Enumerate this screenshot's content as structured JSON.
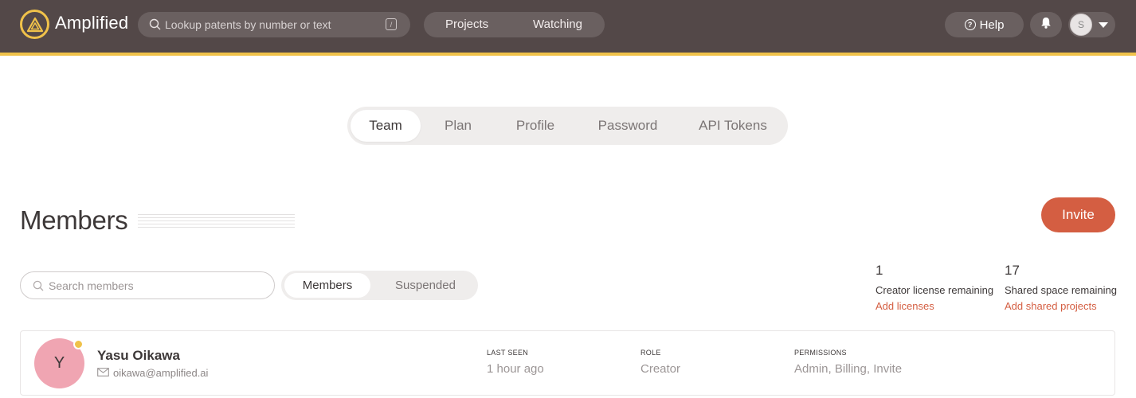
{
  "header": {
    "brand": "Amplified",
    "search_placeholder": "Lookup patents by number or text",
    "search_shortcut": "/",
    "nav": [
      {
        "label": "Projects"
      },
      {
        "label": "Watching"
      }
    ],
    "help_label": "Help",
    "help_glyph": "?",
    "user_initial": "S",
    "accent_color": "#f0c24a"
  },
  "settings_tabs": [
    {
      "label": "Team",
      "active": true
    },
    {
      "label": "Plan"
    },
    {
      "label": "Profile"
    },
    {
      "label": "Password"
    },
    {
      "label": "API Tokens"
    }
  ],
  "members": {
    "title": "Members",
    "invite_label": "Invite",
    "search_placeholder": "Search members",
    "filters": [
      {
        "label": "Members",
        "active": true
      },
      {
        "label": "Suspended"
      }
    ],
    "stats": [
      {
        "value": "1",
        "label": "Creator license remaining",
        "link": "Add licenses"
      },
      {
        "value": "17",
        "label": "Shared space remaining",
        "link": "Add shared projects"
      }
    ],
    "columns": {
      "last_seen": "LAST SEEN",
      "role": "ROLE",
      "permissions": "PERMISSIONS"
    },
    "rows": [
      {
        "initial": "Y",
        "name": "Yasu Oikawa",
        "email": "oikawa@amplified.ai",
        "last_seen": "1 hour ago",
        "role": "Creator",
        "permissions": "Admin, Billing, Invite"
      }
    ]
  },
  "colors": {
    "topbar": "#534848",
    "primary": "#d45e42",
    "avatar": "#f0a5b2"
  }
}
